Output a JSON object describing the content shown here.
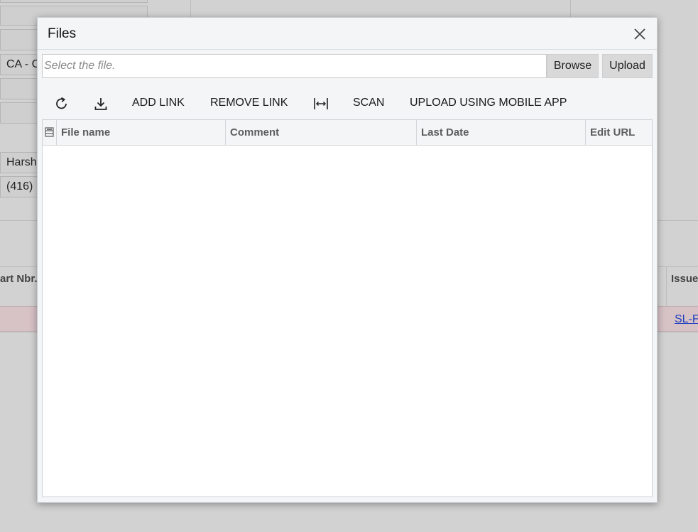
{
  "background": {
    "field_currency": "CA - C",
    "field_contact": "Harsh",
    "field_phone": "(416)",
    "column_part_nbr": "art Nbr.",
    "column_issue": "Issue",
    "row_link": "SL-F"
  },
  "dialog": {
    "title": "Files",
    "close_icon": "close-icon",
    "file_input_placeholder": "Select the file.",
    "browse_label": "Browse",
    "upload_label": "Upload",
    "toolbar": {
      "refresh_icon": "refresh-icon",
      "download_icon": "download-icon",
      "add_link": "ADD LINK",
      "remove_link": "REMOVE LINK",
      "fit_width_icon": "fit-width-icon",
      "scan": "SCAN",
      "upload_mobile": "UPLOAD USING MOBILE APP"
    },
    "grid": {
      "selector_icon": "column-selector-icon",
      "columns": [
        "File name",
        "Comment",
        "Last Date",
        "Edit URL"
      ],
      "rows": []
    }
  },
  "colors": {
    "overlay_bg": "#d2d2d2",
    "dialog_bg": "#f3f5f6",
    "button_gray": "#d9d9d9",
    "link_blue": "#1f3fbf",
    "row_highlight": "#d7c2c6"
  }
}
